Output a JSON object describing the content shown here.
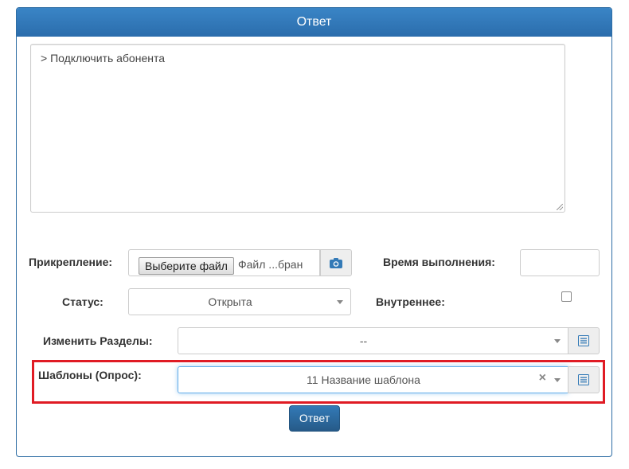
{
  "panel": {
    "title": "Ответ"
  },
  "answer": {
    "text": ">  Подключить абонента"
  },
  "attachment": {
    "label": "Прикрепление:",
    "choose_button": "Выберите файл",
    "file_name": "Файл ...бран"
  },
  "time": {
    "label": "Время выполнения:",
    "value": ""
  },
  "status": {
    "label": "Статус:",
    "value": "Открыта"
  },
  "internal": {
    "label": "Внутреннее:",
    "checked": false
  },
  "sections": {
    "label": "Изменить Разделы:",
    "value": "--"
  },
  "templates": {
    "label": "Шаблоны (Опрос):",
    "value": "11 Название шаблона",
    "clear": "×"
  },
  "submit": {
    "label": "Ответ"
  },
  "colors": {
    "accent": "#337ab7",
    "highlight": "#e01b24"
  }
}
